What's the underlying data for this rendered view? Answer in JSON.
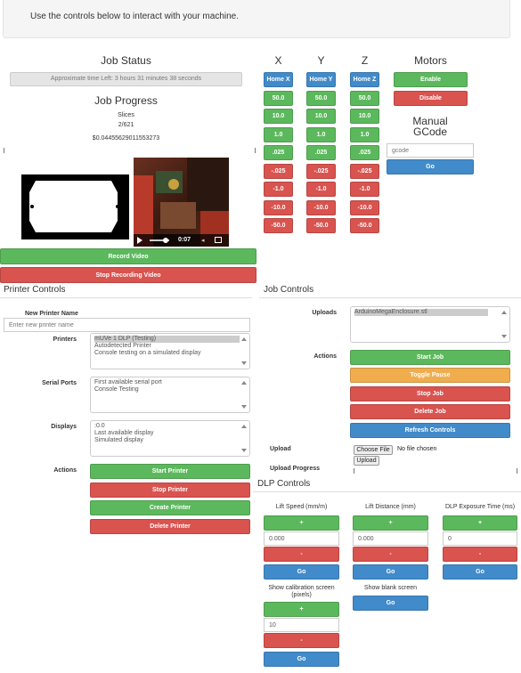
{
  "banner": {
    "text": "Use the controls below to interact with your machine."
  },
  "job_status": {
    "title": "Job Status",
    "time_left": "Approximate time Left: 3 hours 31 minutes 38 seconds",
    "progress_title": "Job Progress",
    "slices_label": "Slices",
    "slices_value": "2/621",
    "cost": "$0.04455629011553273"
  },
  "video": {
    "time": "0:07",
    "record_label": "Record Video",
    "stop_label": "Stop Recording Video"
  },
  "axes": {
    "x": {
      "label": "X",
      "home": "Home X"
    },
    "y": {
      "label": "Y",
      "home": "Home Y"
    },
    "z": {
      "label": "Z",
      "home": "Home Z"
    },
    "positive_steps": [
      "50.0",
      "10.0",
      "1.0",
      ".025"
    ],
    "negative_steps": [
      "-.025",
      "-1.0",
      "-10.0",
      "-50.0"
    ]
  },
  "motors": {
    "title": "Motors",
    "enable": "Enable",
    "disable": "Disable"
  },
  "manual_gcode": {
    "title_line1": "Manual",
    "title_line2": "GCode",
    "placeholder": "gcode",
    "go": "Go"
  },
  "printer_controls": {
    "title": "Printer Controls",
    "new_printer_label": "New Printer Name",
    "new_printer_placeholder": "Enter new printer name",
    "printers_label": "Printers",
    "printers": [
      "mUVe 1 DLP (Testing)",
      "Autodetected Printer",
      "Console testing on a simulated display"
    ],
    "serial_label": "Serial Ports",
    "serial_ports": [
      "First available serial port",
      "Console Testing"
    ],
    "displays_label": "Displays",
    "displays": [
      ":0.0",
      "Last available display",
      "Simulated display"
    ],
    "actions_label": "Actions",
    "start": "Start Printer",
    "stop": "Stop Printer",
    "create": "Create Printer",
    "delete": "Delete Printer"
  },
  "job_controls": {
    "title": "Job Controls",
    "uploads_label": "Uploads",
    "uploads": [
      "ArduinoMegaEnclosure.stl"
    ],
    "actions_label": "Actions",
    "start": "Start Job",
    "pause": "Toggle Pause",
    "stop": "Stop Job",
    "delete": "Delete Job",
    "refresh": "Refresh Controls",
    "upload_label": "Upload",
    "choose_file": "Choose File",
    "no_file": "No file chosen",
    "upload_button": "Upload",
    "upload_progress_label": "Upload Progress"
  },
  "dlp": {
    "title": "DLP Controls",
    "lift_speed_label": "Lift Speed (mm/m)",
    "lift_speed_value": "0.000",
    "lift_distance_label": "Lift Distance (mm)",
    "lift_distance_value": "0.000",
    "exposure_label": "DLP Exposure Time (ms)",
    "exposure_value": "0",
    "calib_label_line1": "Show calibration screen",
    "calib_label_line2": "(pixels)",
    "calib_value": "10",
    "blank_label": "Show blank screen",
    "plus": "+",
    "minus": "-",
    "go": "Go"
  }
}
